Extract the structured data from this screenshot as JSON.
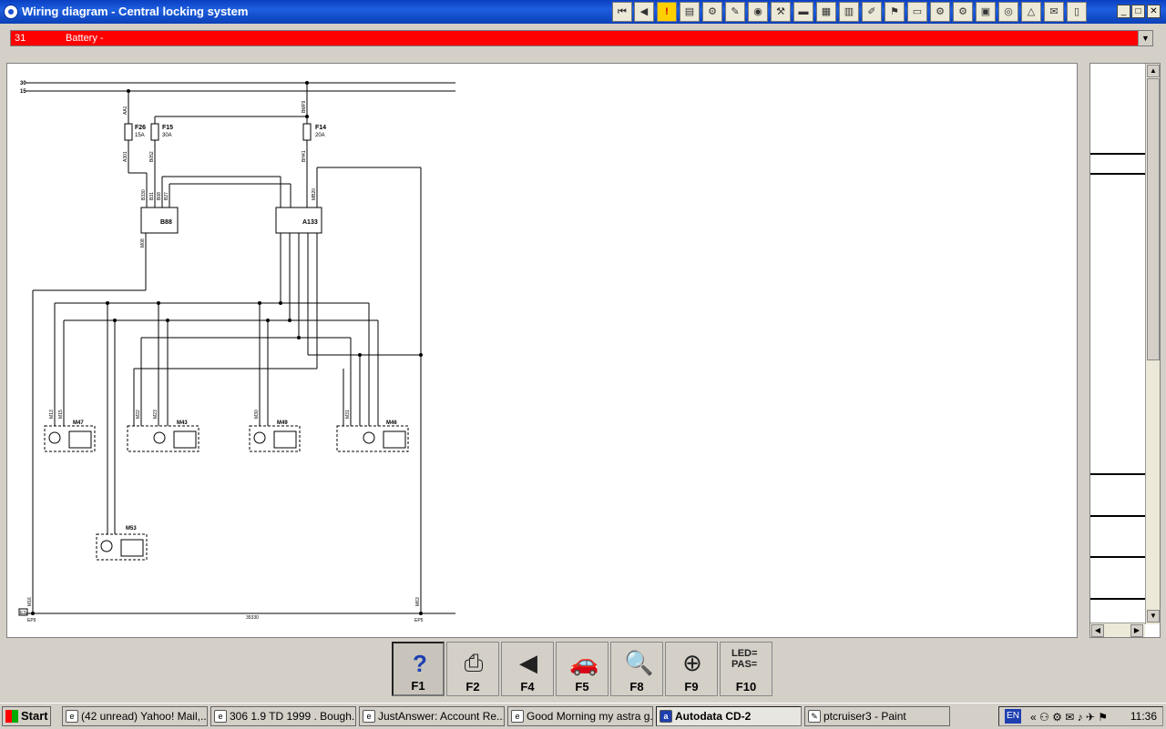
{
  "window": {
    "title": "Wiring diagram - Central locking system"
  },
  "toolbar": {
    "buttons": [
      "first-page",
      "previous-page",
      "warning",
      "tool-1",
      "tool-2",
      "tool-3",
      "tool-4",
      "tool-5",
      "tool-6",
      "tool-7",
      "tool-8",
      "tool-9",
      "tool-10",
      "tool-11",
      "tool-12",
      "tool-13",
      "tool-14",
      "tool-15",
      "tool-16",
      "tool-17",
      "tool-18",
      "tool-19",
      "tool-20"
    ]
  },
  "selector": {
    "code": "31",
    "label": "Battery -"
  },
  "diagram": {
    "rails": [
      "30",
      "15"
    ],
    "fuses": [
      {
        "name": "F26",
        "rating": "15A"
      },
      {
        "name": "F15",
        "rating": "30A"
      },
      {
        "name": "F14",
        "rating": "20A"
      }
    ],
    "modules": [
      "B88",
      "A133"
    ],
    "motors": [
      "M47",
      "M43",
      "M49",
      "M46",
      "M53"
    ],
    "wires": [
      "AA1",
      "A301",
      "B052",
      "BMF9",
      "BH41",
      "B330",
      "B31",
      "B08",
      "B27",
      "MB20",
      "M08",
      "M13",
      "M15",
      "M22",
      "M23",
      "M30",
      "M31"
    ],
    "earth_points": [
      "EP9",
      "EP5"
    ],
    "earth_labels": [
      "M16",
      "M63",
      "35330"
    ],
    "marker": "E2"
  },
  "function_keys": [
    {
      "label": "F1",
      "icon": "help-icon"
    },
    {
      "label": "F2",
      "icon": "print-icon"
    },
    {
      "label": "F4",
      "icon": "back-icon"
    },
    {
      "label": "F5",
      "icon": "car-icon"
    },
    {
      "label": "F8",
      "icon": "zoom-icon"
    },
    {
      "label": "F9",
      "icon": "locate-icon"
    },
    {
      "label": "F10",
      "icon": "led-pas-icon"
    }
  ],
  "f10_icon_text": [
    "LED=",
    "PAS="
  ],
  "taskbar": {
    "start": "Start",
    "tasks": [
      "(42 unread) Yahoo! Mail,...",
      "306 1.9 TD 1999 . Bough...",
      "JustAnswer: Account Re...",
      "Good Morning my astra g...",
      "Autodata CD-2",
      "ptcruiser3 - Paint"
    ],
    "language": "EN",
    "clock": "11:36"
  }
}
